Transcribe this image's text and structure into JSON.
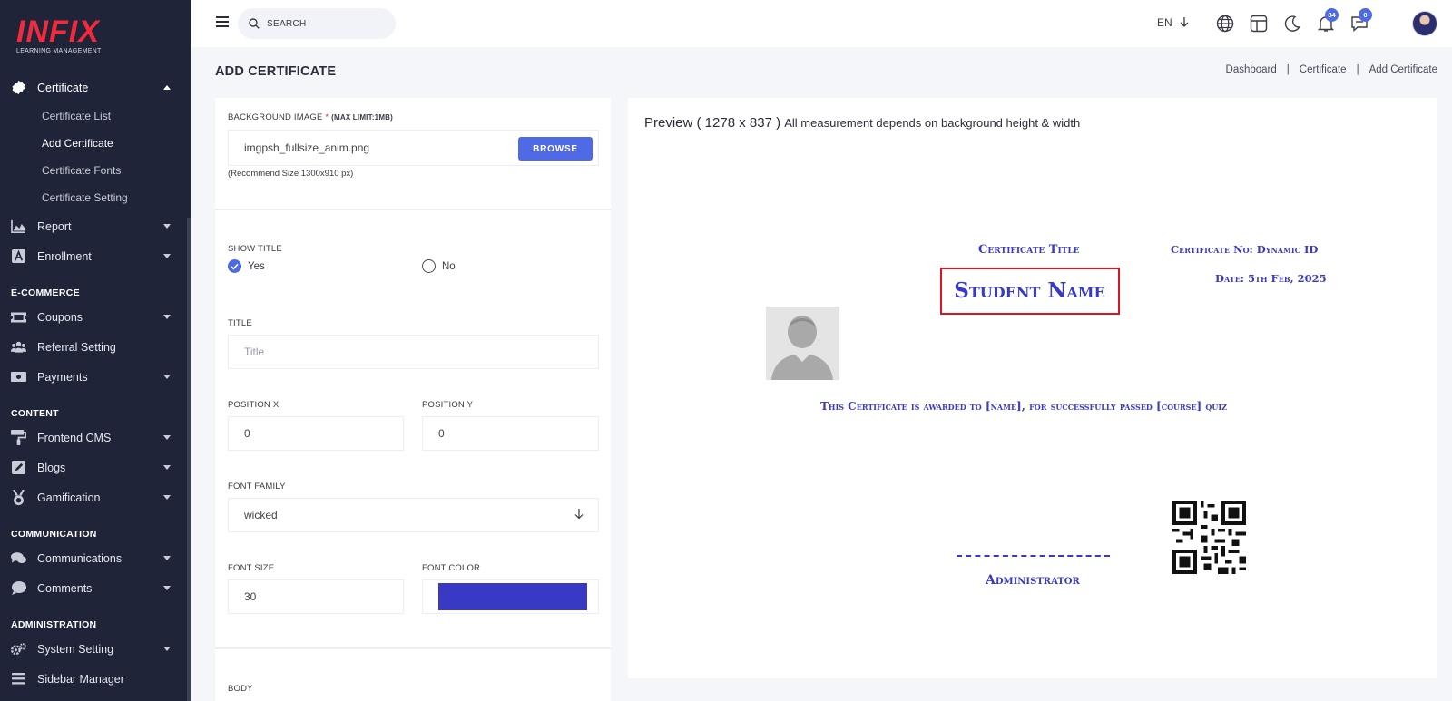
{
  "brand": {
    "logo_text": "INFIX",
    "logo_sub": "LEARNING MANAGEMENT"
  },
  "sidebar": {
    "certificate": {
      "label": "Certificate",
      "sub": [
        "Certificate List",
        "Add Certificate",
        "Certificate Fonts",
        "Certificate Setting"
      ]
    },
    "report": "Report",
    "enrollment": "Enrollment",
    "sections": {
      "ecommerce": "E-COMMERCE",
      "content": "CONTENT",
      "communication": "COMMUNICATION",
      "administration": "ADMINISTRATION"
    },
    "coupons": "Coupons",
    "referral": "Referral Setting",
    "payments": "Payments",
    "frontend_cms": "Frontend CMS",
    "blogs": "Blogs",
    "gamification": "Gamification",
    "communications": "Communications",
    "comments": "Comments",
    "system_setting": "System Setting",
    "sidebar_manager": "Sidebar Manager"
  },
  "topbar": {
    "search_placeholder": "SEARCH",
    "language": "EN",
    "notifications_count": "84",
    "messages_count": "0"
  },
  "page": {
    "title": "ADD CERTIFICATE",
    "breadcrumb": [
      "Dashboard",
      "Certificate",
      "Add Certificate"
    ]
  },
  "form": {
    "bg_label": "BACKGROUND IMAGE",
    "bg_required": "*",
    "bg_limit": "(MAX LIMIT:1MB)",
    "bg_file": "imgpsh_fullsize_anim.png",
    "browse_label": "BROWSE",
    "bg_hint": "(Recommend Size 1300x910 px)",
    "show_title_label": "SHOW TITLE",
    "yes_label": "Yes",
    "no_label": "No",
    "title_label": "TITLE",
    "title_placeholder": "Title",
    "pos_x_label": "POSITION X",
    "pos_x_value": "0",
    "pos_y_label": "POSITION Y",
    "pos_y_value": "0",
    "font_family_label": "FONT FAMILY",
    "font_family_value": "wicked",
    "font_size_label": "FONT SIZE",
    "font_size_value": "30",
    "font_color_label": "FONT COLOR",
    "font_color_value": "#3839c4",
    "body_label": "BODY"
  },
  "preview": {
    "title": "Preview ( 1278 x 837 )",
    "note": "All measurement depends on background height & width",
    "cert_title": "Certificate Title",
    "cert_no": "Certificate No: Dynamic ID",
    "cert_date": "Date: 5th Feb, 2025",
    "student_name": "Student Name",
    "awarded_text": "This Certificate is awarded to [name], for successfully passed [course] quiz",
    "signature_role": "Administrator"
  },
  "colors": {
    "sidebar_bg": "#1f2438",
    "accent": "#4f6ae6",
    "cert_text": "#3839c4",
    "highlight_border": "#e1141e",
    "logo": "#ef2b3c"
  }
}
